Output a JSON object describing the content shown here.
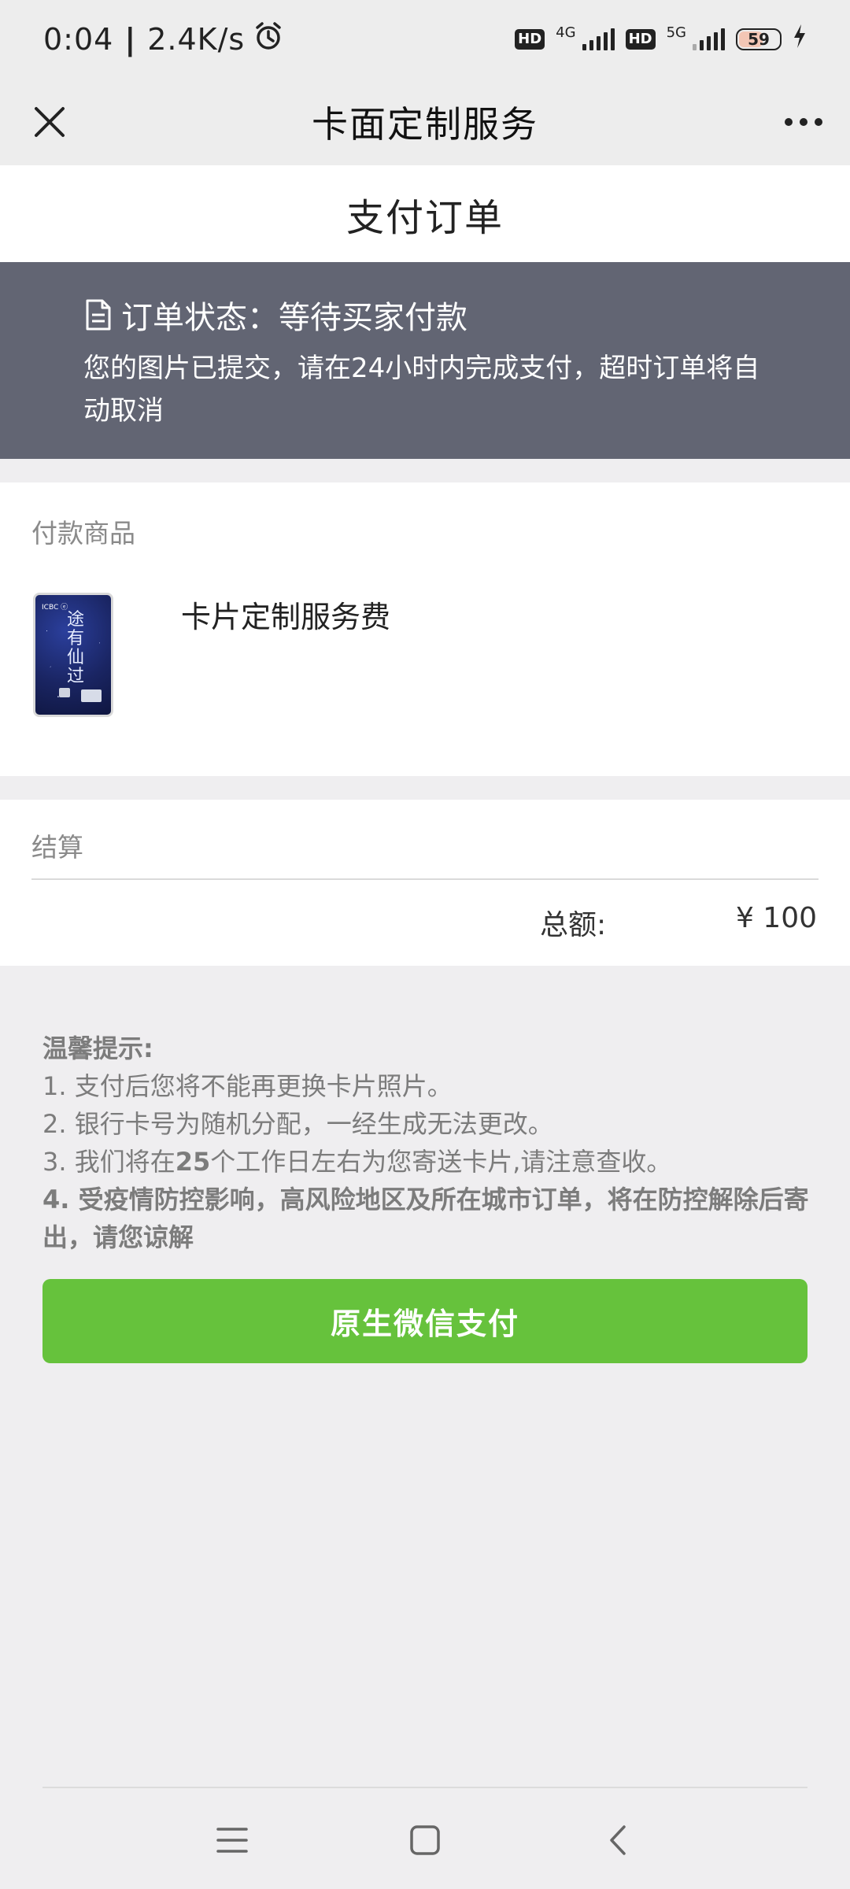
{
  "status_bar": {
    "time": "0:04",
    "separator": "|",
    "speed": "2.4K/s",
    "hd1": "HD",
    "net1": "4G",
    "hd2": "HD",
    "net2": "5G",
    "battery": "59"
  },
  "nav": {
    "title": "卡面定制服务"
  },
  "page": {
    "title": "支付订单"
  },
  "order_status": {
    "label": "订单状态：等待买家付款",
    "description": "您的图片已提交，请在24小时内完成支付，超时订单将自动取消"
  },
  "product": {
    "section_label": "付款商品",
    "name": "卡片定制服务费",
    "card_bank": "ICBC ⓔ",
    "card_text": "途有仙过"
  },
  "settlement": {
    "section_label": "结算",
    "total_label": "总额:",
    "total_value": "¥ 100"
  },
  "tips": {
    "title": "温馨提示:",
    "item1": "1. 支付后您将不能再更换卡片照片。",
    "item2": "2. 银行卡号为随机分配，一经生成无法更改。",
    "item3_prefix": "3. 我们将在",
    "item3_bold": "25",
    "item3_suffix": "个工作日左右为您寄送卡片,请注意查收。",
    "item4": "4. 受疫情防控影响，高风险地区及所在城市订单，将在防控解除后寄出，请您谅解"
  },
  "pay_button": {
    "label": "原生微信支付",
    "color": "#66c23c"
  },
  "icons": {
    "close": "close-icon",
    "more": "more-icon",
    "document": "document-icon",
    "alarm": "alarm-icon",
    "menu": "menu-icon",
    "home": "home-icon",
    "back": "back-icon"
  },
  "colors": {
    "banner_bg": "#626573",
    "page_bg": "#efeef0"
  }
}
